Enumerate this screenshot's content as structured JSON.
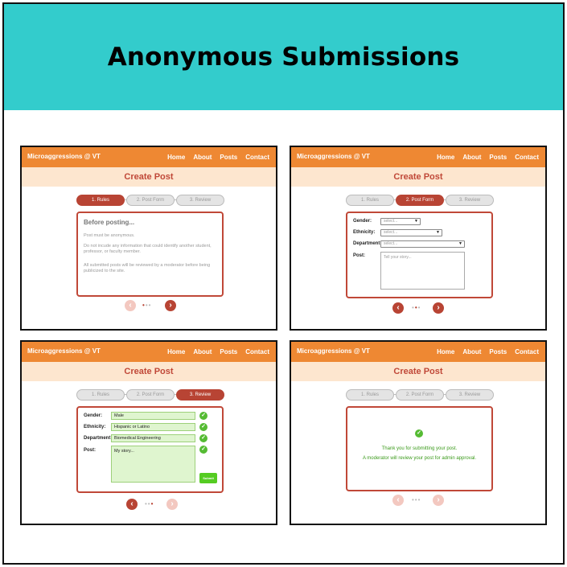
{
  "title": "Anonymous Submissions",
  "nav": {
    "brand": "Microaggressions @ VT",
    "links": [
      "Home",
      "About",
      "Posts",
      "Contact"
    ]
  },
  "page_heading": "Create Post",
  "steps": [
    "1. Rules",
    "2. Post Form",
    "3. Review"
  ],
  "rules": {
    "heading": "Before posting...",
    "items": [
      "Post must be anonymous.",
      "Do not incude any information that could identify another student, professor, or faculty member.",
      "All submitted posts will be reviewed by a moderator before being publicized to the site."
    ]
  },
  "form": {
    "gender_label": "Gender:",
    "ethnicity_label": "Ethnicity:",
    "department_label": "Department:",
    "post_label": "Post:",
    "select_placeholder": "select...",
    "post_placeholder": "Tell your story..."
  },
  "review": {
    "gender_value": "Male",
    "ethnicity_value": "Hispanic or Latino",
    "department_value": "Biomedical Engineering",
    "post_value": "My story...",
    "submit_label": "Submit"
  },
  "confirmation": {
    "line1": "Thank you for submitting your post.",
    "line2": "A moderator will review your post for admin approval."
  },
  "icons": {
    "next": "arrow-right-icon",
    "prev": "arrow-left-icon",
    "check": "check-icon"
  },
  "colors": {
    "banner": "#33cccc",
    "nav": "#ee8833",
    "accent": "#b84434",
    "subheader": "#fde6cf",
    "success": "#55bb33"
  }
}
